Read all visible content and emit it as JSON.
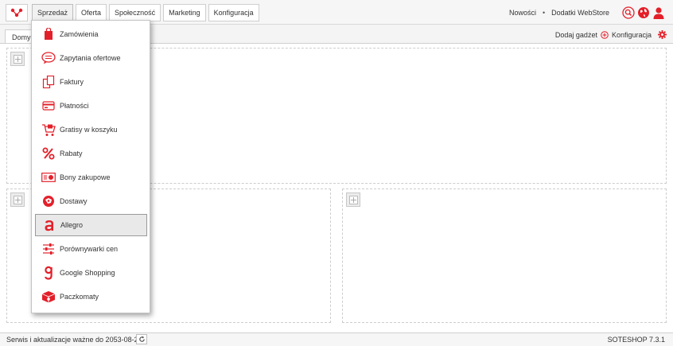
{
  "colors": {
    "accent": "#e3202a"
  },
  "topbar": {
    "logo_icon": "soteshop-logo-icon",
    "nav": [
      {
        "label": "Sprzedaż"
      },
      {
        "label": "Oferta"
      },
      {
        "label": "Społeczność"
      },
      {
        "label": "Marketing"
      },
      {
        "label": "Konfiguracja"
      }
    ],
    "links": {
      "news": "Nowości",
      "separator": "•",
      "addons": "Dodatki WebStore"
    },
    "icons": [
      "search-icon",
      "globe-icon",
      "user-icon"
    ]
  },
  "tabs": {
    "home": "Domyślny"
  },
  "gadget_bar": {
    "add_gadget": "Dodaj gadżet",
    "config": "Konfiguracja"
  },
  "dropdown": {
    "items": [
      {
        "label": "Zamówienia",
        "icon": "shopping-bag-icon"
      },
      {
        "label": "Zapytania ofertowe",
        "icon": "speech-bubble-icon"
      },
      {
        "label": "Faktury",
        "icon": "documents-icon"
      },
      {
        "label": "Płatności",
        "icon": "credit-card-icon"
      },
      {
        "label": "Gratisy w koszyku",
        "icon": "gift-cart-icon"
      },
      {
        "label": "Rabaty",
        "icon": "percent-icon"
      },
      {
        "label": "Bony zakupowe",
        "icon": "voucher-icon"
      },
      {
        "label": "Dostawy",
        "icon": "delivery-globe-icon"
      },
      {
        "label": "Allegro",
        "icon": "allegro-icon"
      },
      {
        "label": "Porównywarki cen",
        "icon": "sliders-icon"
      },
      {
        "label": "Google Shopping",
        "icon": "google-shopping-icon"
      },
      {
        "label": "Paczkomaty",
        "icon": "parcel-locker-icon"
      }
    ],
    "hovered": "Allegro"
  },
  "footer": {
    "status": "Serwis i aktualizacje ważne do 2053-08-26",
    "version": "SOTESHOP 7.3.1"
  }
}
